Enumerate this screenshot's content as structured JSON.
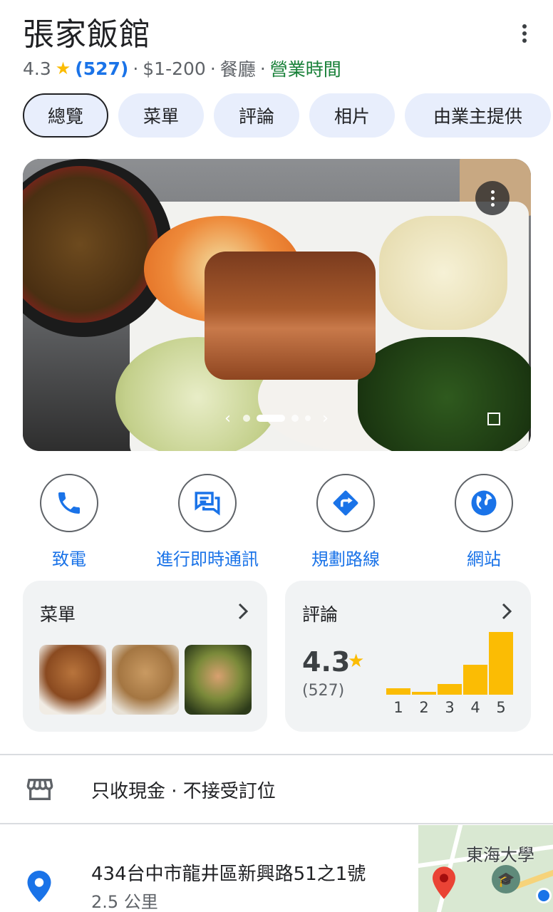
{
  "header": {
    "title": "張家飯館",
    "rating": "4.3",
    "review_count": "(527)",
    "price": "$1-200",
    "category": "餐廳",
    "hours_link": "營業時間",
    "separator": "·"
  },
  "tabs": [
    "總覽",
    "菜單",
    "評論",
    "相片",
    "由業主提供"
  ],
  "actions": [
    {
      "label": "致電",
      "icon": "phone-icon"
    },
    {
      "label": "進行即時通訊",
      "icon": "chat-icon"
    },
    {
      "label": "規劃路線",
      "icon": "directions-icon"
    },
    {
      "label": "網站",
      "icon": "globe-icon"
    }
  ],
  "menu_card": {
    "title": "菜單"
  },
  "review_card": {
    "title": "評論",
    "rating": "4.3",
    "count": "(527)",
    "distribution": [
      {
        "stars": "1",
        "fraction": 0.1
      },
      {
        "stars": "2",
        "fraction": 0.05
      },
      {
        "stars": "3",
        "fraction": 0.17
      },
      {
        "stars": "4",
        "fraction": 0.48
      },
      {
        "stars": "5",
        "fraction": 1.0
      }
    ]
  },
  "info": {
    "payment": "只收現金 · 不接受訂位",
    "address": "434台中市龍井區新興路51之1號",
    "distance": "2.5 公里",
    "map_label": "東海大學"
  },
  "colors": {
    "accent": "#1a73e8",
    "open": "#188038",
    "star": "#fbbc04",
    "tab_bg": "#e8eefc"
  }
}
